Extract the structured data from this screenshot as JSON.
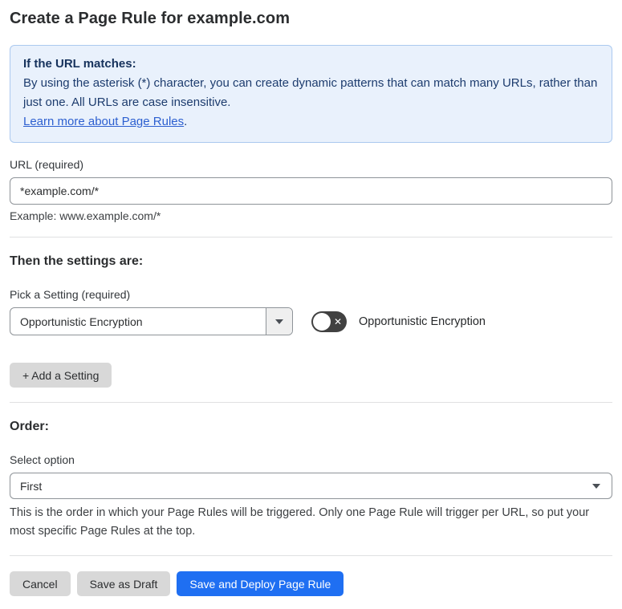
{
  "page": {
    "title": "Create a Page Rule for example.com"
  },
  "info_box": {
    "heading": "If the URL matches:",
    "body": "By using the asterisk (*) character, you can create dynamic patterns that can match many URLs, rather than just one. All URLs are case insensitive.",
    "link_label": "Learn more about Page Rules",
    "link_suffix": "."
  },
  "url_field": {
    "label": "URL (required)",
    "value": "*example.com/*",
    "helper": "Example: www.example.com/*"
  },
  "settings_section": {
    "heading": "Then the settings are:",
    "picker_label": "Pick a Setting (required)",
    "selected_setting": "Opportunistic Encryption",
    "toggle_state": "off",
    "toggle_label": "Opportunistic Encryption",
    "add_setting_label": "+ Add a Setting"
  },
  "order_section": {
    "heading": "Order:",
    "select_label": "Select option",
    "selected_option": "First",
    "helper": "This is the order in which your Page Rules will be triggered. Only one Page Rule will trigger per URL, so put your most specific Page Rules at the top."
  },
  "footer": {
    "cancel_label": "Cancel",
    "save_draft_label": "Save as Draft",
    "save_deploy_label": "Save and Deploy Page Rule"
  },
  "icons": {
    "toggle_off_x": "✕"
  },
  "colors": {
    "accent_blue": "#1f6ff2",
    "info_bg": "#e9f1fc",
    "info_border": "#abc9ef",
    "info_text": "#1d3c6e",
    "link_blue": "#2c5fd0",
    "toggle_bg": "#414141",
    "button_gray": "#d8d8d8"
  }
}
